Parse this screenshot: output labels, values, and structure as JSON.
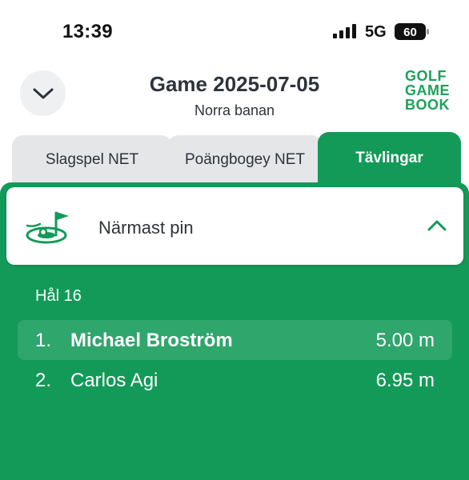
{
  "status": {
    "time": "13:39",
    "network": "5G",
    "battery": "60"
  },
  "header": {
    "title": "Game 2025-07-05",
    "subtitle": "Norra banan",
    "logo_lines": [
      "GOLF",
      "GAME",
      "BOOK"
    ]
  },
  "tabs": [
    {
      "label": "Slagspel NET",
      "active": false
    },
    {
      "label": "Poängbogey NET",
      "active": false
    },
    {
      "label": "Tävlingar",
      "active": true
    }
  ],
  "competition": {
    "title": "Närmast pin",
    "icon": "golf-hole-flag-icon",
    "expanded": true
  },
  "hole": {
    "label": "Hål 16"
  },
  "results": [
    {
      "rank": "1.",
      "name": "Michael Broström",
      "distance": "5.00 m"
    },
    {
      "rank": "2.",
      "name": "Carlos Agi",
      "distance": "6.95 m"
    }
  ],
  "colors": {
    "accent": "#139a58",
    "tab_inactive": "#e4e6e8",
    "text": "#2e333b"
  }
}
